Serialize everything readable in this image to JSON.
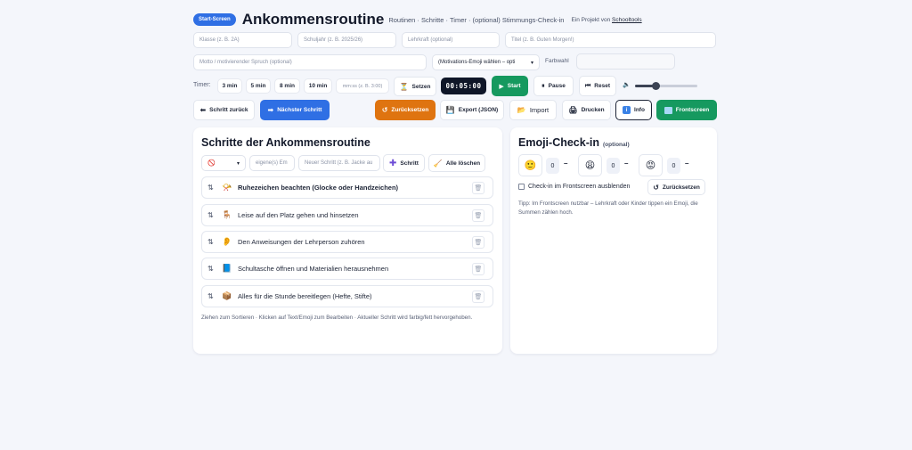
{
  "header": {
    "badge": "Start-Screen",
    "title": "Ankommensroutine",
    "subtitle": "Routinen · Schritte · Timer · (optional) Stimmungs-Check-in",
    "project_prefix": "Ein Projekt von",
    "project_link": "Schooltools"
  },
  "meta": {
    "klasse_placeholder": "Klasse (z. B. 2A)",
    "schuljahr_placeholder": "Schuljahr (z. B. 2025/26)",
    "lehrkraft_placeholder": "Lehrkraft (optional)",
    "titel_placeholder": "Titel (z. B. Guten Morgen!)",
    "motto_placeholder": "Motto / motivierender Spruch (optional)",
    "motivation_select": "(Motivations-Emoji wählen – opti",
    "farbwahl_label": "Farbwahl"
  },
  "timer": {
    "label": "Timer:",
    "presets": [
      "3 min",
      "5 min",
      "8 min",
      "10 min"
    ],
    "custom_placeholder": "mm:ss (z. B. 3:00)",
    "set_label": "Setzen",
    "display": "00:05:00",
    "start_label": "Start",
    "pause_label": "Pause",
    "reset_label": "Reset",
    "volume": 0.33
  },
  "toolbar": {
    "prev_label": "Schritt zurück",
    "next_label": "Nächster Schritt",
    "reset_label": "Zurücksetzen",
    "export_label": "Export (JSON)",
    "import_label": "Import",
    "print_label": "Drucken",
    "info_label": "Info",
    "frontscreen_label": "Frontscreen"
  },
  "steps_panel": {
    "title": "Schritte der Ankommensroutine",
    "emoji_select": "🚫",
    "own_emoji_placeholder": "eigene(s) Em",
    "new_step_placeholder": "Neuer Schritt (z. B. Jacke au",
    "add_label": "Schritt",
    "clear_label": "Alle löschen",
    "steps": [
      {
        "emoji": "📯",
        "text": "Ruhezeichen beachten (Glocke oder Handzeichen)"
      },
      {
        "emoji": "🪑",
        "text": "Leise auf den Platz gehen und hinsetzen"
      },
      {
        "emoji": "👂",
        "text": "Den Anweisungen der Lehrperson zuhören"
      },
      {
        "emoji": "📘",
        "text": "Schultasche öffnen und Materialien herausnehmen"
      },
      {
        "emoji": "📦",
        "text": "Alles für die Stunde bereitlegen (Hefte, Stifte)"
      }
    ],
    "hint": "Ziehen zum Sortieren · Klicken auf Text/Emoji zum Bearbeiten · Aktueller Schritt wird farbig/fett hervorgehoben."
  },
  "emoji_panel": {
    "title": "Emoji-Check-in",
    "optional": "(optional)",
    "moods": [
      {
        "emoji": "🙂",
        "count": "0"
      },
      {
        "emoji": "😩",
        "count": "0"
      },
      {
        "emoji": "😡",
        "count": "0"
      }
    ],
    "minus": "–",
    "hide_label": "Check-in im Frontscreen ausblenden",
    "reset_label": "Zurücksetzen",
    "tip": "Tipp: Im Frontscreen nutzbar – Lehrkraft oder Kinder tippen ein Emoji, die Summen zählen hoch."
  }
}
